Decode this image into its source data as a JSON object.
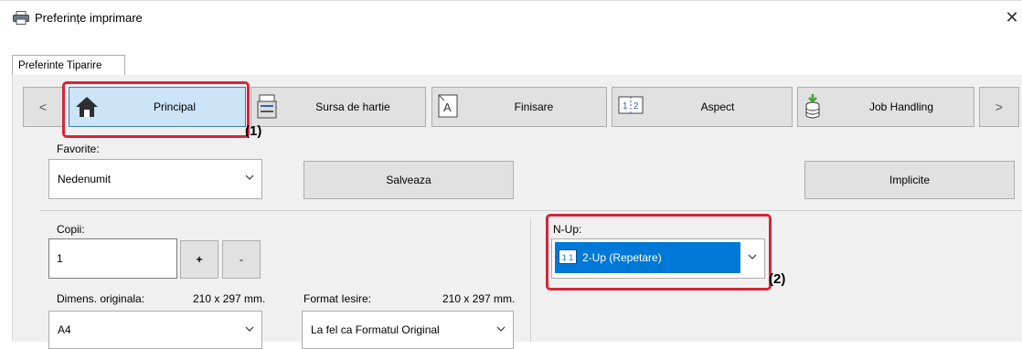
{
  "window": {
    "title": "Preferințe imprimare"
  },
  "tabs": [
    {
      "label": "Preferinte Tiparire"
    }
  ],
  "nav": {
    "prev": "<",
    "next": ">",
    "items": [
      {
        "label": "Principal",
        "icon": "home-icon"
      },
      {
        "label": "Sursa de hartie",
        "icon": "paper-tray-icon"
      },
      {
        "label": "Finisare",
        "icon": "finishing-icon"
      },
      {
        "label": "Aspect",
        "icon": "layout-icon"
      },
      {
        "label": "Job Handling",
        "icon": "job-handling-icon"
      }
    ]
  },
  "favorites": {
    "label": "Favorite:",
    "value": "Nedenumit",
    "save": "Salveaza",
    "defaults": "Implicite"
  },
  "copies": {
    "label": "Copii:",
    "value": "1",
    "plus": "+",
    "minus": "-"
  },
  "original_size": {
    "label": "Dimens. originala:",
    "dims": "210 x 297 mm.",
    "value": "A4"
  },
  "output_format": {
    "label": "Format Iesire:",
    "dims": "210 x 297 mm.",
    "value": "La fel ca Formatul Original"
  },
  "nup": {
    "label": "N-Up:",
    "value": "2-Up (Repetare)",
    "icon_text": "1 1"
  },
  "callouts": {
    "one": "(1)",
    "two": "(2)"
  },
  "colors": {
    "accent": "#0078d7",
    "selected_nav": "#cce4f7",
    "callout": "#d5253a"
  }
}
